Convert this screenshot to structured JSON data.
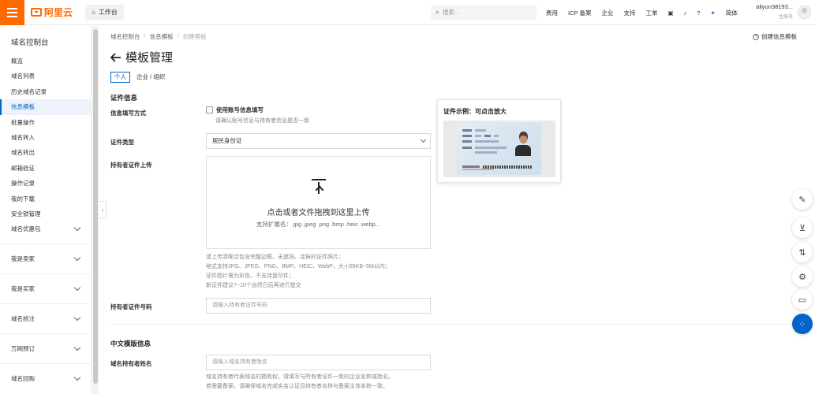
{
  "topbar": {
    "logo_text": "阿里云",
    "workbench": "工作台",
    "search_placeholder": "搜索...",
    "nav": [
      "费用",
      "ICP 备案",
      "企业",
      "支持",
      "工单"
    ],
    "lang": "简体",
    "user_name": "aliyun38193...",
    "user_role": "主账号"
  },
  "sidebar": {
    "title": "域名控制台",
    "items": [
      {
        "label": "概览",
        "active": false
      },
      {
        "label": "域名列表",
        "active": false
      },
      {
        "label": "历史域名记录",
        "active": false
      },
      {
        "label": "信息模板",
        "active": true
      },
      {
        "label": "批量操作",
        "active": false
      },
      {
        "label": "域名转入",
        "active": false
      },
      {
        "label": "域名转出",
        "active": false
      },
      {
        "label": "邮箱验证",
        "active": false
      },
      {
        "label": "操作记录",
        "active": false
      },
      {
        "label": "我的下载",
        "active": false
      },
      {
        "label": "安全锁管理",
        "active": false
      }
    ],
    "groups": [
      "域名优惠包",
      "我是卖家",
      "我是买家",
      "域名抢注",
      "万网预订",
      "域名回购"
    ]
  },
  "breadcrumb": [
    "域名控制台",
    "信息模板",
    "创建模板"
  ],
  "help_link": "创建信息模板",
  "page_title": "模板管理",
  "tabs": [
    {
      "label": "个人",
      "active": true
    },
    {
      "label": "企业 / 组织",
      "active": false
    }
  ],
  "cert_section": {
    "heading": "证件信息",
    "fill_method_label": "信息填写方式",
    "use_account_checkbox": "使用账号信息填写",
    "use_account_hint": "请确认账号信息与持有者信息是否一致",
    "cert_type_label": "证件类型",
    "cert_type_value": "居民身份证",
    "upload_label": "持有者证件上传",
    "upload_main": "点击或者文件拖拽到这里上传",
    "upload_sub": "支持扩展名：.jpg .jpeg .png .bmp .heic .webp...",
    "upload_hints": [
      "请上传清晰且包含完整边框、无遮挡、涂抹的证件照片；",
      "格式支持JPG、JPEG、PNG、BMP、HEIC、WebP，大小55KB~5M以内；",
      "证件图片需为彩色，不支持复印件；",
      "新证件建议7~10个自然日后再进行提交"
    ],
    "cert_no_label": "持有者证件号码",
    "cert_no_placeholder": "请输入持有者证件号码"
  },
  "cn_section": {
    "heading": "中文模版信息",
    "holder_name_label": "域名持有者姓名",
    "holder_name_placeholder": "请输入域名持有者姓名",
    "holder_hints": [
      "域名持有者代表域名的拥有权，请填写与所有者证件一致的企业名称或姓名。",
      "若需要备案，请确保域名完成实名认证且持有者名称与备案主体名称一致。"
    ]
  },
  "popover": {
    "title": "证件示例：可点击放大"
  },
  "colors": {
    "brand": "#ff6a00",
    "primary": "#0064c8"
  },
  "float_tools": [
    "edit-icon",
    "cart-icon",
    "transfer-icon",
    "settings-icon",
    "message-icon",
    "apps-icon"
  ]
}
